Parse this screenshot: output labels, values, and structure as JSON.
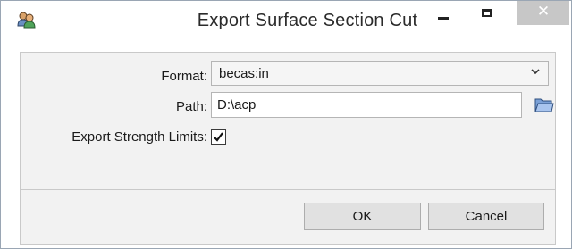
{
  "window": {
    "title": "Export Surface Section Cut",
    "icons": {
      "app": "users-icon",
      "minimize": "minimize-icon",
      "maximize": "maximize-icon",
      "close": "close-icon"
    }
  },
  "form": {
    "format_label": "Format:",
    "format_value": "becas:in",
    "path_label": "Path:",
    "path_value": "D:\\acp",
    "strength_label": "Export Strength Limits:",
    "strength_checked": true
  },
  "buttons": {
    "ok": "OK",
    "cancel": "Cancel"
  },
  "colors": {
    "panel_bg": "#f2f2f2",
    "button_bg": "#e1e1e1",
    "close_bg": "#c7c7c7"
  }
}
